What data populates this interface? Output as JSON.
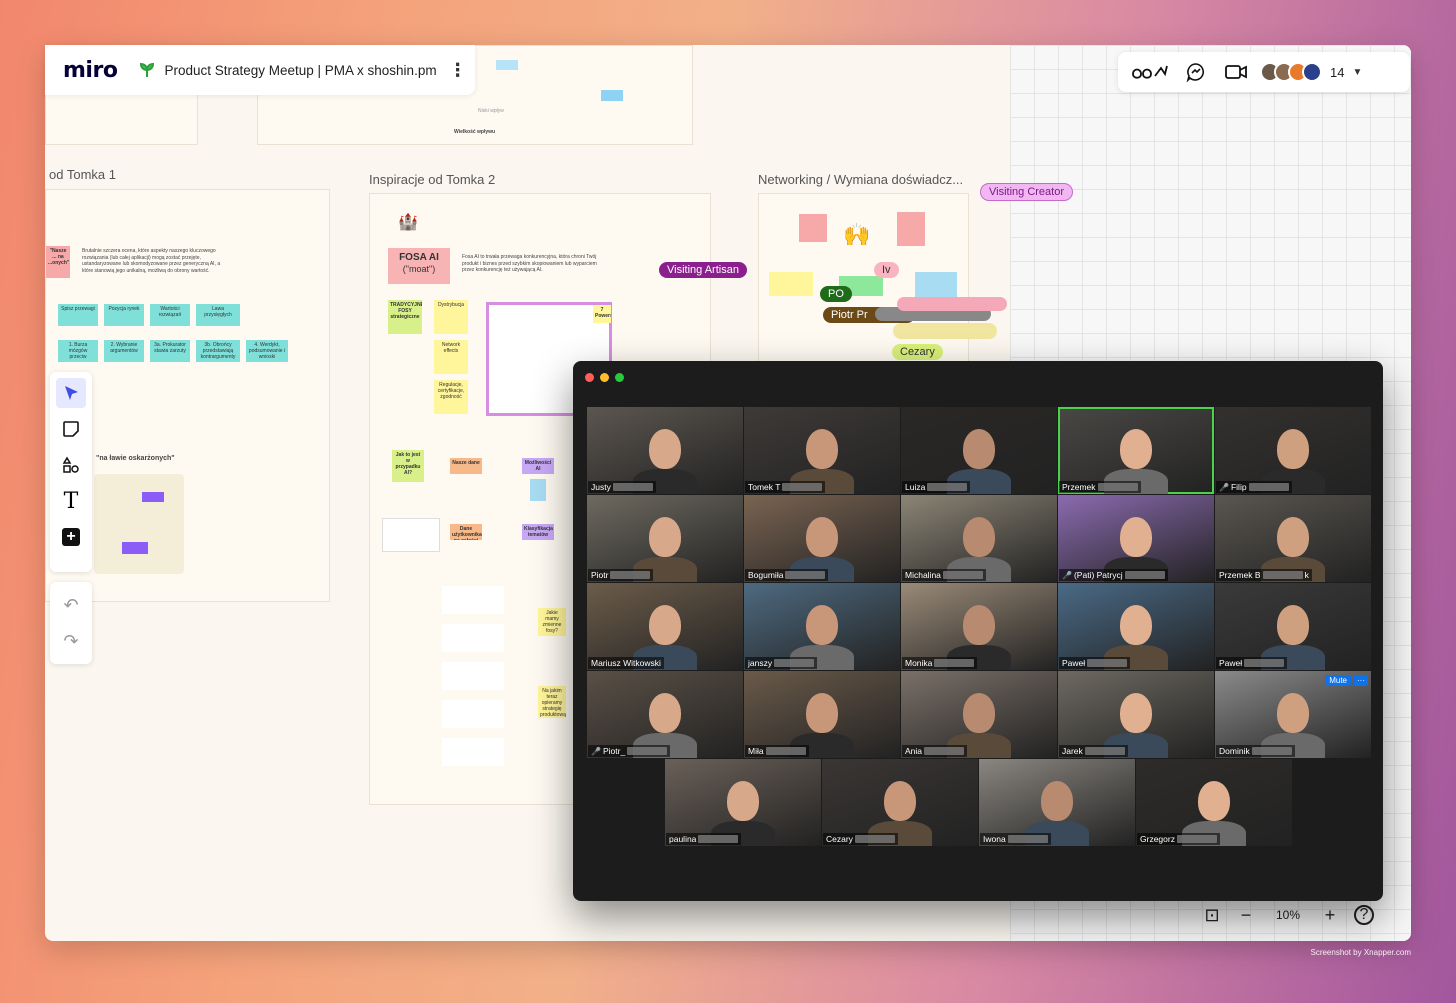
{
  "app": {
    "logo": "miro",
    "board_title": "Product Strategy Meetup | PMA x shoshin.pm",
    "participant_count": "14",
    "zoom_level": "10%"
  },
  "board": {
    "frames": [
      {
        "title": "od Tomka 1"
      },
      {
        "title": "Inspiracje od Tomka 2"
      },
      {
        "title": "Networking / Wymiana doświadcz..."
      }
    ],
    "top_frame_label": "Wielkość wpływu",
    "top_small_label": "Niski wpływ",
    "frame1": {
      "pink_note": "\"Nasze ... na ...onych\"",
      "intro_text": "Brutalnie szczera ocena, które aspekty naszego kluczowego rozwiązania (lub całej aplikacji) mogą zostać przejęte, ustandaryzowane lub skomodyzowane przez generyczną AI, a które stanowią jego unikalną, możliwą do obrony wartość.",
      "row1": [
        "Spisz przewagi",
        "Pozycja rynek",
        "Wartości rozwiązań",
        "Lawa przysięgłych"
      ],
      "row2": [
        "1. Burza mózgów przeciw",
        "2. Wybranie argumentów",
        "3a. Prokurator stawia zarzuty",
        "3b. Obrońcy przedstawiają kontrargumenty",
        "4. Werdykt, podsumowanie i wnioski"
      ],
      "heading": "\"na ławie oskarżonych\""
    },
    "frame2": {
      "fosa_title": "FOSA AI",
      "fosa_sub": "(\"moat\")",
      "fosa_desc": "Fosa AI to trwała przewaga konkurencyjna, która chroni Twój produkt i biznes przed szybkim skopiowaniem lub wyparciem przez konkurencję też używającą AI.",
      "stickies": [
        "TRADYCYJNE FOSY strategiczne",
        "Dystrybucja",
        "Network effects",
        "Regulacje, certyfikacje, zgodność"
      ],
      "flow": [
        "Jak to jest w przypadku AI?",
        "Nasze dane",
        "Możliwości AI",
        "Dane użytkownika na całości",
        "Klasyfikacja tematów"
      ],
      "yellow_right": [
        "Jakie mamy zmienne fosy?",
        "Na jakim teraz opieramy strategię produktową?"
      ],
      "powers": "7 Powers"
    },
    "frame3": {
      "cursors": [
        "PO",
        "Piotr Pr",
        "Iv",
        "Cezary"
      ]
    },
    "cursor_labels": [
      "Visiting Artisan",
      "Visiting Creator"
    ]
  },
  "zoom": {
    "participants": [
      {
        "name": "Justy",
        "muted": false
      },
      {
        "name": "Tomek T",
        "muted": false
      },
      {
        "name": "Luiza",
        "muted": false
      },
      {
        "name": "Przemek",
        "muted": false
      },
      {
        "name": "Filip",
        "muted": true
      },
      {
        "name": "Piotr",
        "muted": false
      },
      {
        "name": "Bogumiła",
        "muted": false
      },
      {
        "name": "Michalina",
        "muted": false
      },
      {
        "name": "(Pati) Patrycj",
        "muted": true
      },
      {
        "name": "Przemek B",
        "muted": false
      },
      {
        "name": "Mariusz Witkowski",
        "muted": false
      },
      {
        "name": "janszy",
        "muted": false
      },
      {
        "name": "Monika",
        "muted": false
      },
      {
        "name": "Paweł",
        "muted": false
      },
      {
        "name": "Paweł",
        "muted": false
      },
      {
        "name": "Piotr_",
        "muted": true
      },
      {
        "name": "Miła",
        "muted": false
      },
      {
        "name": "Ania",
        "muted": false
      },
      {
        "name": "Jarek",
        "muted": false
      },
      {
        "name": "Dominik",
        "muted": false
      },
      {
        "name": "paulina",
        "muted": false
      },
      {
        "name": "Cezary",
        "muted": false
      },
      {
        "name": "Iwona",
        "muted": false
      },
      {
        "name": "Grzegorz",
        "muted": false
      }
    ],
    "mute_button": "Mute",
    "more_button": "···",
    "name_suffix_k": "k"
  },
  "watermark": "Screenshot by Xnapper.com",
  "colors": {
    "miro_yellow": "#ffd02f",
    "cursor_purple": "#8b1f8e",
    "active_speaker": "#4bd14b",
    "zoom_blue": "#0e72ed"
  }
}
